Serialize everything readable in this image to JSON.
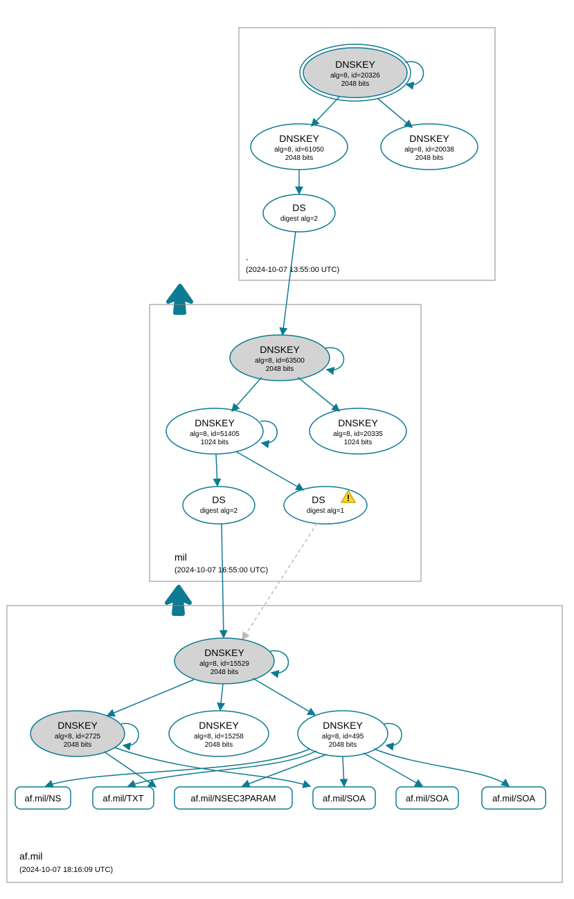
{
  "zones": {
    "root": {
      "label": ".",
      "date": "(2024-10-07 13:55:00 UTC)"
    },
    "mil": {
      "label": "mil",
      "date": "(2024-10-07 16:55:00 UTC)"
    },
    "afmil": {
      "label": "af.mil",
      "date": "(2024-10-07 18:16:09 UTC)"
    }
  },
  "nodes": {
    "root_ksk": {
      "title": "DNSKEY",
      "sub1": "alg=8, id=20326",
      "sub2": "2048 bits"
    },
    "root_zsk1": {
      "title": "DNSKEY",
      "sub1": "alg=8, id=61050",
      "sub2": "2048 bits"
    },
    "root_zsk2": {
      "title": "DNSKEY",
      "sub1": "alg=8, id=20038",
      "sub2": "2048 bits"
    },
    "root_ds": {
      "title": "DS",
      "sub1": "digest alg=2"
    },
    "mil_ksk": {
      "title": "DNSKEY",
      "sub1": "alg=8, id=63500",
      "sub2": "2048 bits"
    },
    "mil_zsk1": {
      "title": "DNSKEY",
      "sub1": "alg=8, id=51405",
      "sub2": "1024 bits"
    },
    "mil_zsk2": {
      "title": "DNSKEY",
      "sub1": "alg=8, id=20335",
      "sub2": "1024 bits"
    },
    "mil_ds1": {
      "title": "DS",
      "sub1": "digest alg=2"
    },
    "mil_ds2": {
      "title": "DS",
      "sub1": "digest alg=1"
    },
    "af_ksk": {
      "title": "DNSKEY",
      "sub1": "alg=8, id=15529",
      "sub2": "2048 bits"
    },
    "af_zsk1": {
      "title": "DNSKEY",
      "sub1": "alg=8, id=2725",
      "sub2": "2048 bits"
    },
    "af_zsk2": {
      "title": "DNSKEY",
      "sub1": "alg=8, id=15258",
      "sub2": "2048 bits"
    },
    "af_zsk3": {
      "title": "DNSKEY",
      "sub1": "alg=8, id=495",
      "sub2": "2048 bits"
    },
    "rr_ns": {
      "label": "af.mil/NS"
    },
    "rr_txt": {
      "label": "af.mil/TXT"
    },
    "rr_nsec3": {
      "label": "af.mil/NSEC3PARAM"
    },
    "rr_soa1": {
      "label": "af.mil/SOA"
    },
    "rr_soa2": {
      "label": "af.mil/SOA"
    },
    "rr_soa3": {
      "label": "af.mil/SOA"
    }
  }
}
